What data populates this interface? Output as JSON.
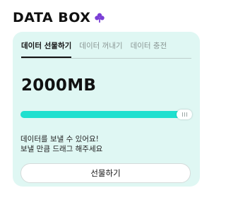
{
  "header": {
    "logo_text": "DATA BOX",
    "logo_icon": "clover-icon",
    "accent_color": "#7b3fd6"
  },
  "tabs": [
    {
      "label": "데이터 선물하기",
      "active": true
    },
    {
      "label": "데이터 꺼내기",
      "active": false
    },
    {
      "label": "데이터 충전",
      "active": false
    }
  ],
  "amount": "2000MB",
  "slider": {
    "value_fraction": 1.0,
    "fill_color": "#1fe0cf",
    "track_color": "#c6e8e3"
  },
  "description": {
    "line1": "데이터를 보낼 수 있어요!",
    "line2": "보낼 만큼 드래그 해주세요"
  },
  "gift_button": {
    "label": "선물하기"
  },
  "colors": {
    "card_background": "#dff7f3"
  }
}
